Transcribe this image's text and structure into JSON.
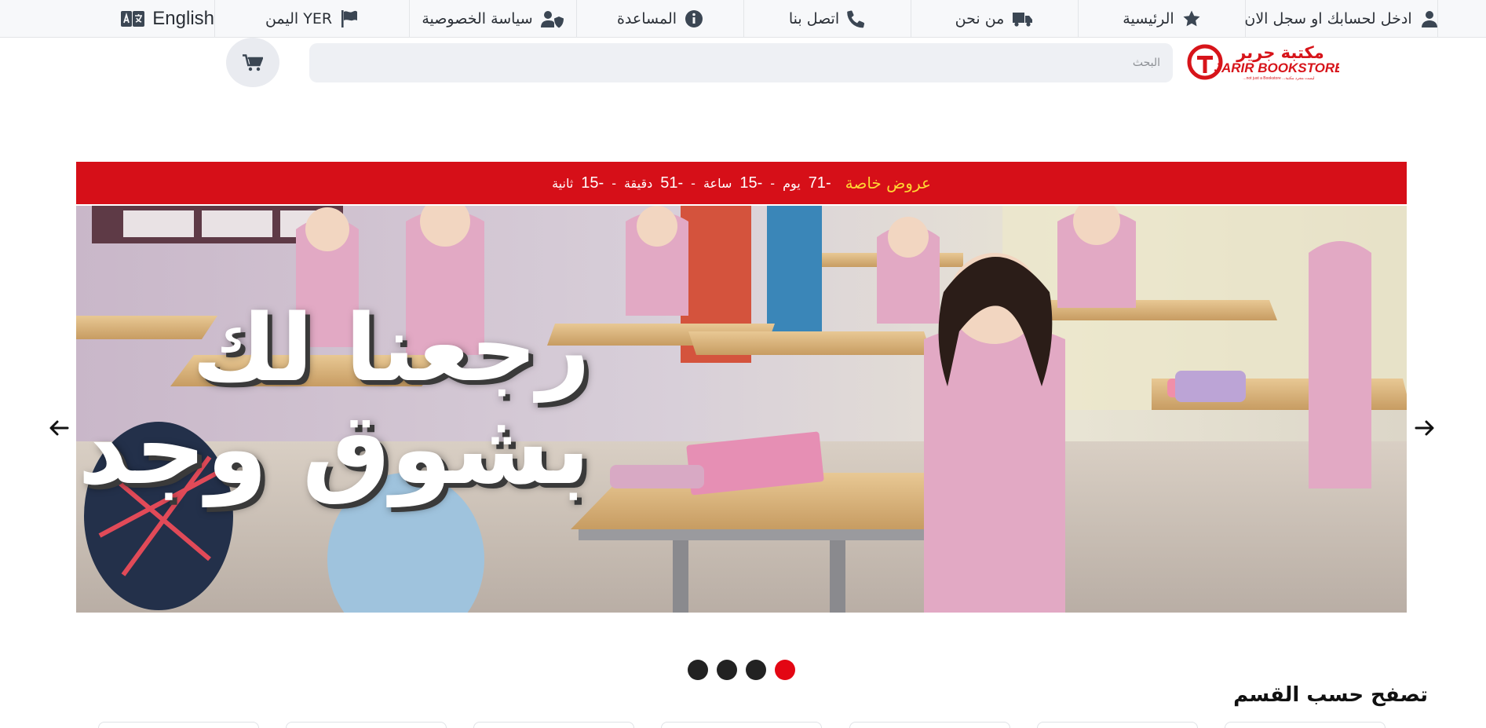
{
  "topbar": {
    "items": [
      {
        "label": "ادخل لحسابك او سجل الان",
        "icon": "user-icon"
      },
      {
        "label": "الرئيسية",
        "icon": "star-icon"
      },
      {
        "label": "من نحن",
        "icon": "truck-icon"
      },
      {
        "label": "اتصل بنا",
        "icon": "phone-icon"
      },
      {
        "label": "المساعدة",
        "icon": "info-circle-icon"
      },
      {
        "label": "سياسة الخصوصية",
        "icon": "user-shield-icon"
      },
      {
        "label": "اليمن YER",
        "icon": "flag-icon"
      },
      {
        "label": "English",
        "icon": "language-icon"
      }
    ]
  },
  "header": {
    "logo_arabic": "مكتبة جرير",
    "logo_english": "JARIR BOOKSTORE",
    "logo_tagline": "...not just a Bookstore  ...ليست مجرد مكتبة",
    "search_placeholder": "البحث",
    "cart_icon": "cart-icon"
  },
  "offer": {
    "title": "عروض خاصة",
    "days_value": "-71",
    "days_label": "يوم",
    "hours_value": "-15",
    "hours_label": "ساعة",
    "minutes_value": "-51",
    "minutes_label": "دقيقة",
    "seconds_value": "-15",
    "seconds_label": "ثانية",
    "separator": "-",
    "colors": {
      "bar": "#d60f18",
      "title": "#ffd633"
    }
  },
  "banner": {
    "headline_line1": "رجعنا لك",
    "headline_line2": "بشوق وجد",
    "prev_icon": "arrow-left-icon",
    "next_icon": "arrow-right-icon"
  },
  "carousel": {
    "slides": 4,
    "active_index": 4,
    "active_color": "#e30613"
  },
  "sections": {
    "browse_by_category": "تصفح حسب القسم"
  }
}
